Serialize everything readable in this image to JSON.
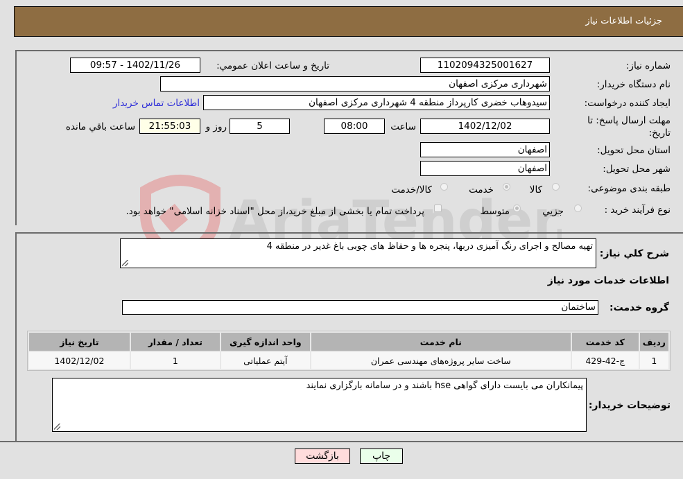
{
  "header": {
    "title": "جزئیات اطلاعات نیاز"
  },
  "fields": {
    "need_number_label": "شماره نیاز:",
    "need_number": "1102094325001627",
    "announce_label": "تاریخ و ساعت اعلان عمومي:",
    "announce_value": "1402/11/26 - 09:57",
    "buyer_org_label": "نام دستگاه خریدار:",
    "buyer_org": "شهرداری مرکزی اصفهان",
    "creator_label": "ایجاد کننده درخواست:",
    "creator": "سیدوهاب خضری کارپرداز منطقه 4 شهرداری مرکزی اصفهان",
    "contact_link": "اطلاعات تماس خریدار",
    "deadline_label": "مهلت ارسال پاسخ: تا تاریخ:",
    "deadline_date": "1402/12/02",
    "time_label": "ساعت",
    "deadline_time": "08:00",
    "days_value": "5",
    "days_label": "روز و",
    "remaining_time": "21:55:03",
    "remaining_label": "ساعت باقي مانده",
    "province_label": "استان محل تحویل:",
    "province": "اصفهان",
    "city_label": "شهر محل تحویل:",
    "city": "اصفهان",
    "category_label": "طبقه بندی موضوعی:",
    "category_options": [
      {
        "label": "کالا",
        "checked": false
      },
      {
        "label": "خدمت",
        "checked": true
      },
      {
        "label": "کالا/خدمت",
        "checked": false
      }
    ],
    "process_label": "نوع فرآیند خرید :",
    "process_options": [
      {
        "label": "جزيي",
        "checked": false
      },
      {
        "label": "متوسط",
        "checked": true
      }
    ],
    "treasury_note": "پرداخت تمام یا بخشی از مبلغ خرید،از محل \"اسناد خزانه اسلامی\" خواهد بود."
  },
  "description": {
    "label": "شرح کلي نياز:",
    "value": "تهیه مصالح و اجرای رنگ آمیزی دربها، پنجره ها و حفاظ های چوبی باغ غدیر در منطقه 4"
  },
  "services": {
    "section_title": "اطلاعات خدمات مورد نیاز",
    "group_label": "گروه خدمت:",
    "group_value": "ساختمان",
    "table": {
      "headers": [
        "ردیف",
        "کد خدمت",
        "نام خدمت",
        "واحد اندازه گیری",
        "تعداد / مقدار",
        "تاریخ نیاز"
      ],
      "rows": [
        [
          "1",
          "ج-42-429",
          "ساخت سایر پروژه‌های مهندسی عمران",
          "آیتم عملیاتی",
          "1",
          "1402/12/02"
        ]
      ]
    }
  },
  "buyer_notes": {
    "label": "توضیحات خریدار:",
    "value": "پیمانکاران می بایست دارای گواهی hse باشند و در سامانه بارگزاری نمایند"
  },
  "buttons": {
    "print": "چاپ",
    "back": "بازگشت"
  },
  "colors": {
    "header_bg": "#8e6d42",
    "print_bg": "#eaffea",
    "back_bg": "#ffdcdc",
    "link": "#2b2bd8"
  },
  "watermark": {
    "text": "AriaTender.neT"
  }
}
